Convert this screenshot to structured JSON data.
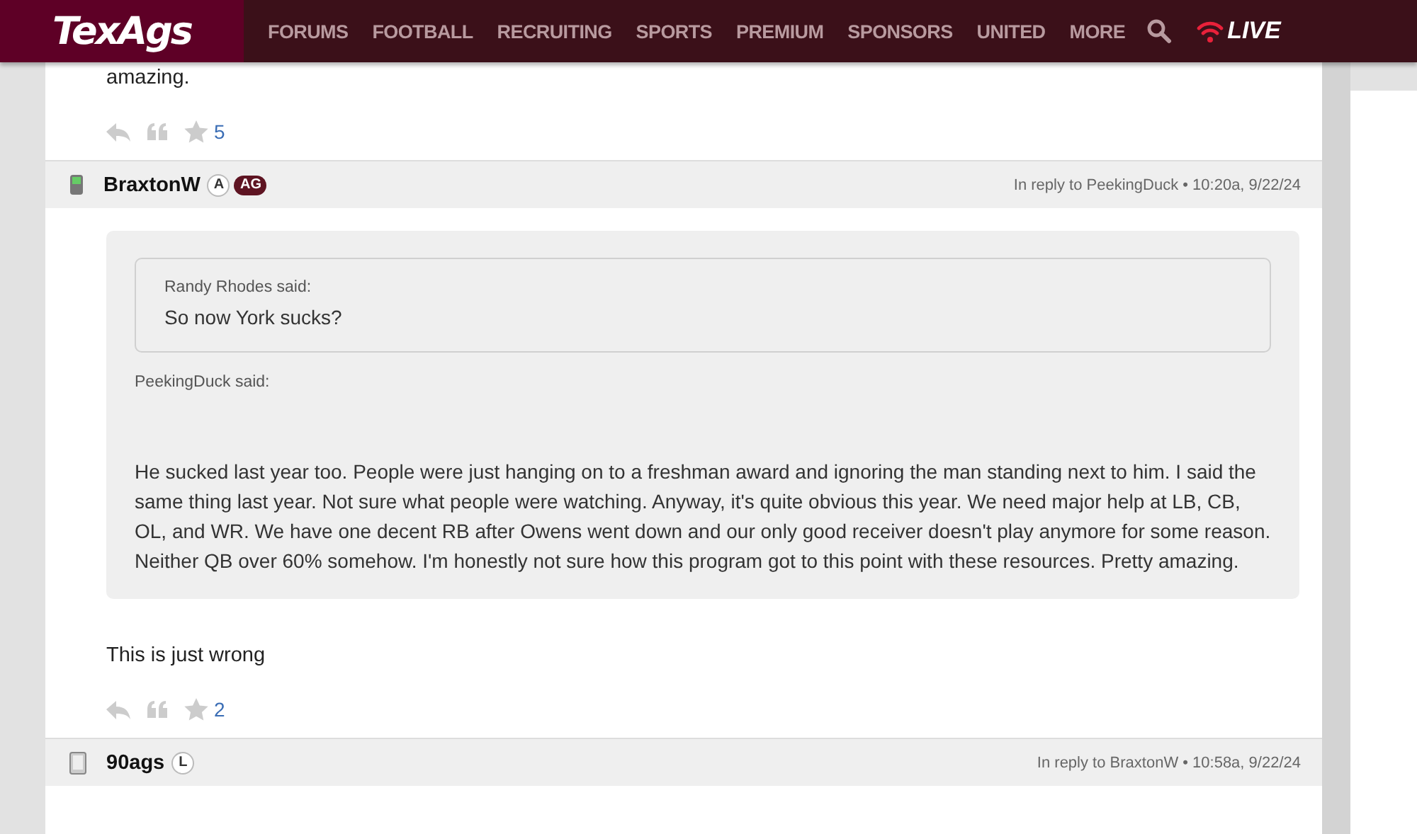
{
  "nav": {
    "logo": "TexAgs",
    "items": [
      "FORUMS",
      "FOOTBALL",
      "RECRUITING",
      "SPORTS",
      "PREMIUM",
      "SPONSORS",
      "UNITED",
      "MORE"
    ],
    "live": "LIVE"
  },
  "posts": [
    {
      "body": "amazing.",
      "star_count": "5"
    },
    {
      "kind": "phone",
      "author": "BraxtonW",
      "badges": [
        {
          "text": "A",
          "kind": "circle"
        },
        {
          "text": "AG",
          "kind": "pill"
        }
      ],
      "meta": "In reply to PeekingDuck • 10:20a, 9/22/24",
      "quote": {
        "inner": {
          "author": "Randy Rhodes said:",
          "text": "So now York sucks?"
        },
        "author": "PeekingDuck said:",
        "text": "He sucked last year too. People were just hanging on to a freshman award and ignoring the man standing next to him. I said the same thing last year. Not sure what people were watching. Anyway, it's quite obvious this year. We need major help at LB, CB, OL, and WR. We have one decent RB after Owens went down and our only good receiver doesn't play anymore for some reason. Neither QB over 60% somehow. I'm honestly not sure how this program got to this point with these resources. Pretty amazing."
      },
      "body": "This is just wrong",
      "star_count": "2"
    },
    {
      "kind": "tablet",
      "author": "90ags",
      "badges": [
        {
          "text": "L",
          "kind": "circle"
        }
      ],
      "meta": "In reply to BraxtonW • 10:58a, 9/22/24"
    }
  ]
}
